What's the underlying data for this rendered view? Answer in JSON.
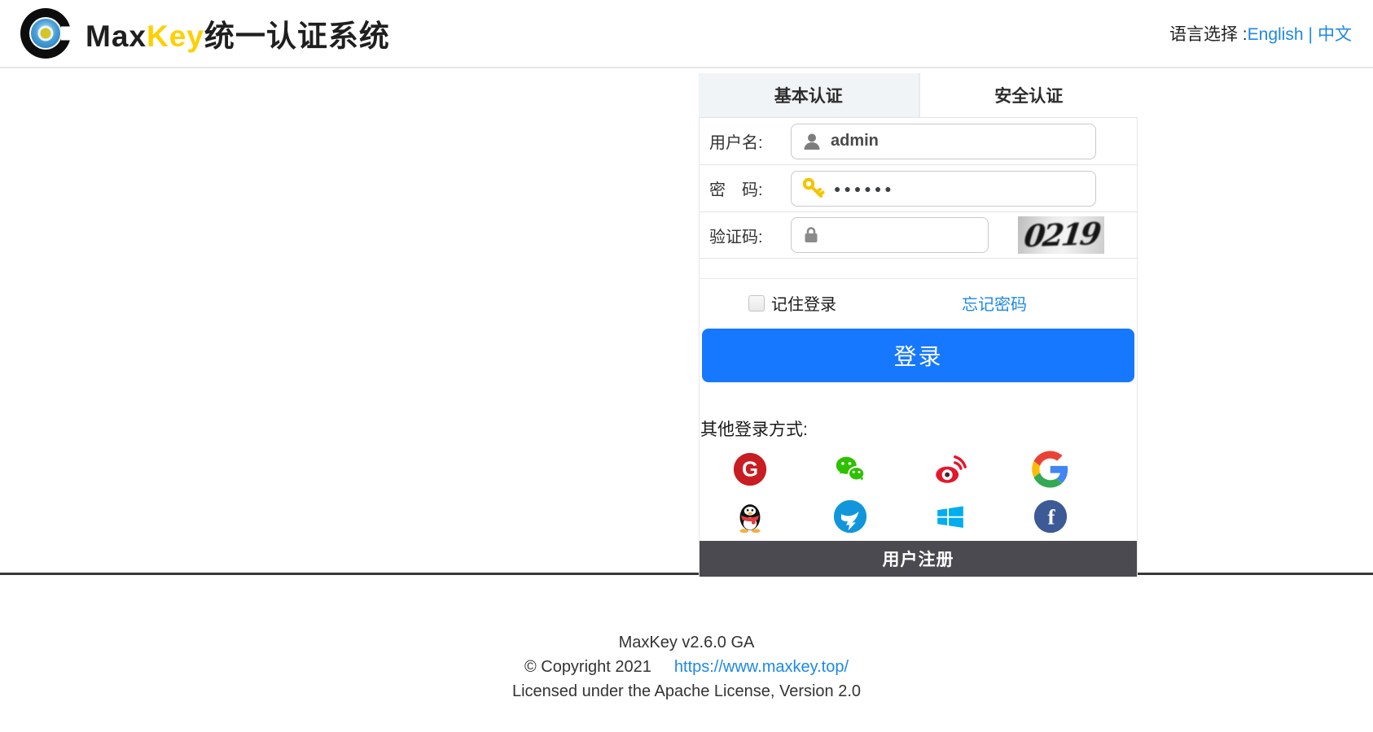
{
  "header": {
    "title": {
      "part1": "Max",
      "part2": "Key",
      "part3": "统一认证系统"
    },
    "language": {
      "label": "语言选择 :",
      "english": "English",
      "separator": "|",
      "chinese": "中文"
    }
  },
  "login_panel": {
    "tabs": [
      {
        "label": "基本认证",
        "active": true
      },
      {
        "label": "安全认证",
        "active": false
      }
    ],
    "fields": {
      "username": {
        "label": "用户名:",
        "value": "admin",
        "icon": "user-icon"
      },
      "password": {
        "label": "密　码:",
        "value": "●●●●●●",
        "icon": "key-icon"
      },
      "captcha": {
        "label": "验证码:",
        "value": "",
        "icon": "lock-icon",
        "image_text": "0219"
      }
    },
    "remember": {
      "label": "记住登录",
      "checked": false
    },
    "forgot_link": "忘记密码",
    "login_button": "登录",
    "other_methods_label": "其他登录方式:",
    "social_providers": [
      "gitee",
      "wechat",
      "weibo",
      "google",
      "qq",
      "dingtalk",
      "microsoft",
      "facebook"
    ],
    "register_bar": "用户注册"
  },
  "footer": {
    "version": "MaxKey  v2.6.0 GA",
    "copyright": "© Copyright 2021",
    "link": "https://www.maxkey.top/",
    "license": "Licensed under the Apache License, Version 2.0"
  },
  "colors": {
    "accent_blue": "#1677ff",
    "link_blue": "#1e88e5",
    "brand_yellow": "#fdd000",
    "register_bar_bg": "#4a4a50",
    "tab_active_bg": "#f1f4f6"
  }
}
